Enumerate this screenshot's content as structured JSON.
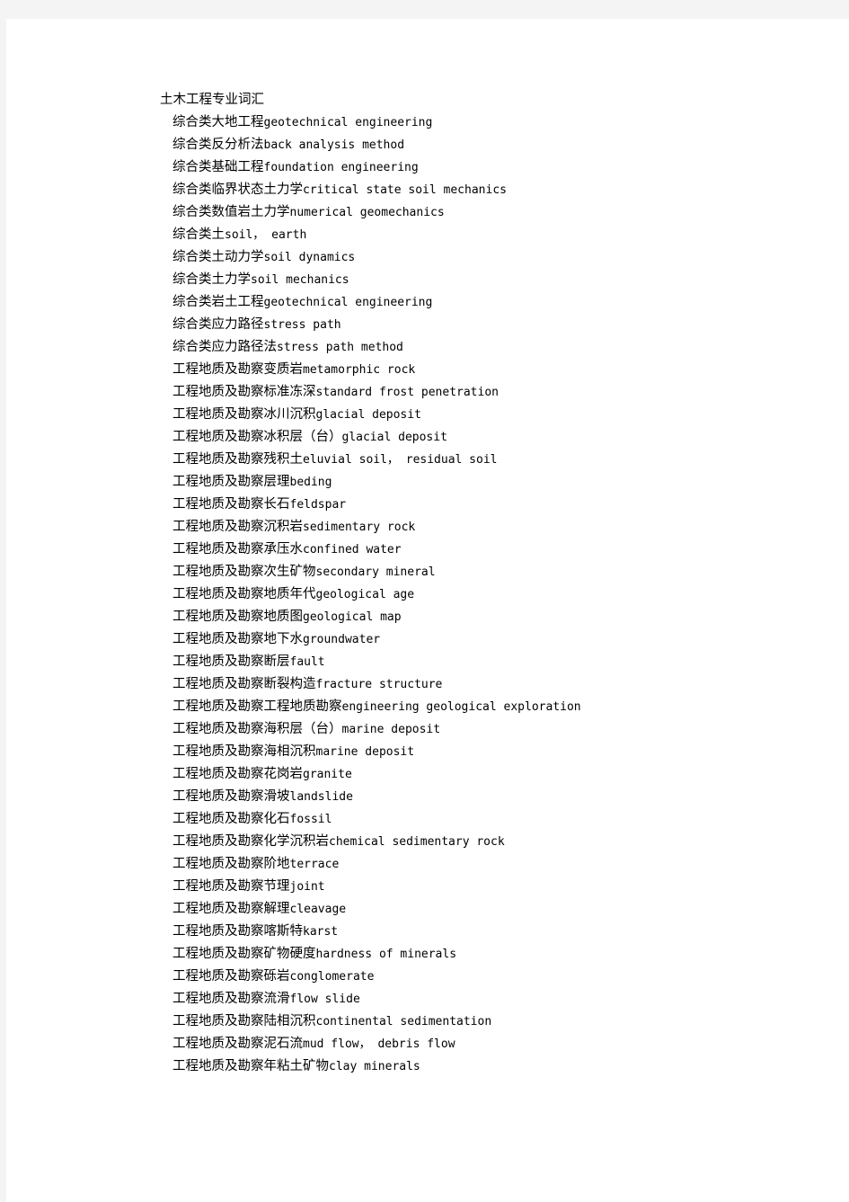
{
  "document": {
    "title": "土木工程专业词汇",
    "entries": [
      {
        "category": "综合类",
        "term": "大地工程",
        "gloss": "geotechnical engineering"
      },
      {
        "category": "综合类",
        "term": "反分析法",
        "gloss": "back analysis method"
      },
      {
        "category": "综合类",
        "term": "基础工程",
        "gloss": "foundation engineering"
      },
      {
        "category": "综合类",
        "term": "临界状态土力学",
        "gloss": "critical state soil mechanics"
      },
      {
        "category": "综合类",
        "term": "数值岩土力学",
        "gloss": "numerical geomechanics"
      },
      {
        "category": "综合类",
        "term": "土",
        "gloss": "soil， earth"
      },
      {
        "category": "综合类",
        "term": "土动力学",
        "gloss": "soil dynamics"
      },
      {
        "category": "综合类",
        "term": "土力学",
        "gloss": "soil mechanics"
      },
      {
        "category": "综合类",
        "term": "岩土工程",
        "gloss": "geotechnical engineering"
      },
      {
        "category": "综合类",
        "term": "应力路径",
        "gloss": "stress path"
      },
      {
        "category": "综合类",
        "term": "应力路径法",
        "gloss": "stress path method"
      },
      {
        "category": "工程地质及勘察",
        "term": "变质岩",
        "gloss": "metamorphic rock"
      },
      {
        "category": "工程地质及勘察",
        "term": "标准冻深",
        "gloss": "standard frost penetration"
      },
      {
        "category": "工程地质及勘察",
        "term": "冰川沉积",
        "gloss": "glacial deposit"
      },
      {
        "category": "工程地质及勘察",
        "term": "冰积层（台）",
        "gloss": "glacial deposit"
      },
      {
        "category": "工程地质及勘察",
        "term": "残积土",
        "gloss": "eluvial soil， residual soil"
      },
      {
        "category": "工程地质及勘察",
        "term": "层理",
        "gloss": "beding"
      },
      {
        "category": "工程地质及勘察",
        "term": "长石",
        "gloss": "feldspar"
      },
      {
        "category": "工程地质及勘察",
        "term": "沉积岩",
        "gloss": "sedimentary rock"
      },
      {
        "category": "工程地质及勘察",
        "term": "承压水",
        "gloss": "confined water"
      },
      {
        "category": "工程地质及勘察",
        "term": "次生矿物",
        "gloss": "secondary mineral"
      },
      {
        "category": "工程地质及勘察",
        "term": "地质年代",
        "gloss": "geological age"
      },
      {
        "category": "工程地质及勘察",
        "term": "地质图",
        "gloss": "geological map"
      },
      {
        "category": "工程地质及勘察",
        "term": "地下水",
        "gloss": "groundwater"
      },
      {
        "category": "工程地质及勘察",
        "term": "断层",
        "gloss": "fault"
      },
      {
        "category": "工程地质及勘察",
        "term": "断裂构造",
        "gloss": "fracture structure"
      },
      {
        "category": "工程地质及勘察",
        "term": "工程地质勘察",
        "gloss": "engineering geological exploration"
      },
      {
        "category": "工程地质及勘察",
        "term": "海积层（台）",
        "gloss": "marine deposit"
      },
      {
        "category": "工程地质及勘察",
        "term": "海相沉积",
        "gloss": "marine deposit"
      },
      {
        "category": "工程地质及勘察",
        "term": "花岗岩",
        "gloss": "granite"
      },
      {
        "category": "工程地质及勘察",
        "term": "滑坡",
        "gloss": "landslide"
      },
      {
        "category": "工程地质及勘察",
        "term": "化石",
        "gloss": "fossil"
      },
      {
        "category": "工程地质及勘察",
        "term": "化学沉积岩",
        "gloss": "chemical sedimentary rock"
      },
      {
        "category": "工程地质及勘察",
        "term": "阶地",
        "gloss": "terrace"
      },
      {
        "category": "工程地质及勘察",
        "term": "节理",
        "gloss": "joint"
      },
      {
        "category": "工程地质及勘察",
        "term": "解理",
        "gloss": "cleavage"
      },
      {
        "category": "工程地质及勘察",
        "term": "喀斯特",
        "gloss": "karst"
      },
      {
        "category": "工程地质及勘察",
        "term": "矿物硬度",
        "gloss": "hardness of minerals"
      },
      {
        "category": "工程地质及勘察",
        "term": "砾岩",
        "gloss": "conglomerate"
      },
      {
        "category": "工程地质及勘察",
        "term": "流滑",
        "gloss": "flow slide"
      },
      {
        "category": "工程地质及勘察",
        "term": "陆相沉积",
        "gloss": "continental sedimentation"
      },
      {
        "category": "工程地质及勘察",
        "term": "泥石流",
        "gloss": "mud flow， debris flow"
      },
      {
        "category": "工程地质及勘察",
        "term": "年粘土矿物",
        "gloss": "clay minerals"
      }
    ]
  },
  "colors": {
    "page_background": "#ffffff",
    "canvas_background": "#f4f4f4",
    "text": "#000000"
  }
}
